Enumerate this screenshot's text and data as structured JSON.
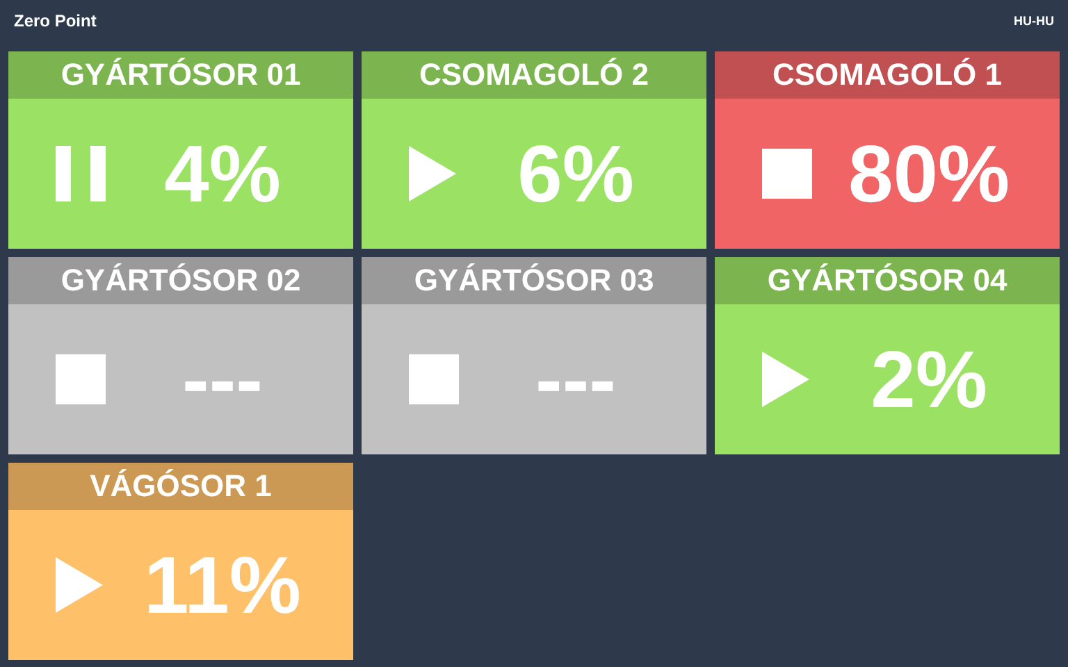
{
  "app_bar": {
    "title": "Zero Point",
    "locale": "HU-HU"
  },
  "tiles": [
    {
      "name": "GYÁRTÓSOR 01",
      "color": "#9be164",
      "kind": "paused",
      "value": "4%"
    },
    {
      "name": "CSOMAGOLÓ 2",
      "color": "#9be164",
      "kind": "running",
      "value": "6%"
    },
    {
      "name": "CSOMAGOLÓ 1",
      "color": "#f06466",
      "kind": "stopped",
      "value": "80%"
    },
    {
      "name": "GYÁRTÓSOR 02",
      "color": "#c1c1c1",
      "kind": "stopped",
      "value": "---"
    },
    {
      "name": "GYÁRTÓSOR 03",
      "color": "#c1c1c1",
      "kind": "stopped",
      "value": "---"
    },
    {
      "name": "GYÁRTÓSOR 04",
      "color": "#9be164",
      "kind": "running",
      "value": "2%"
    },
    {
      "name": "VÁGÓSOR 1",
      "color": "#ffc06a",
      "kind": "running",
      "value": "11%"
    }
  ]
}
